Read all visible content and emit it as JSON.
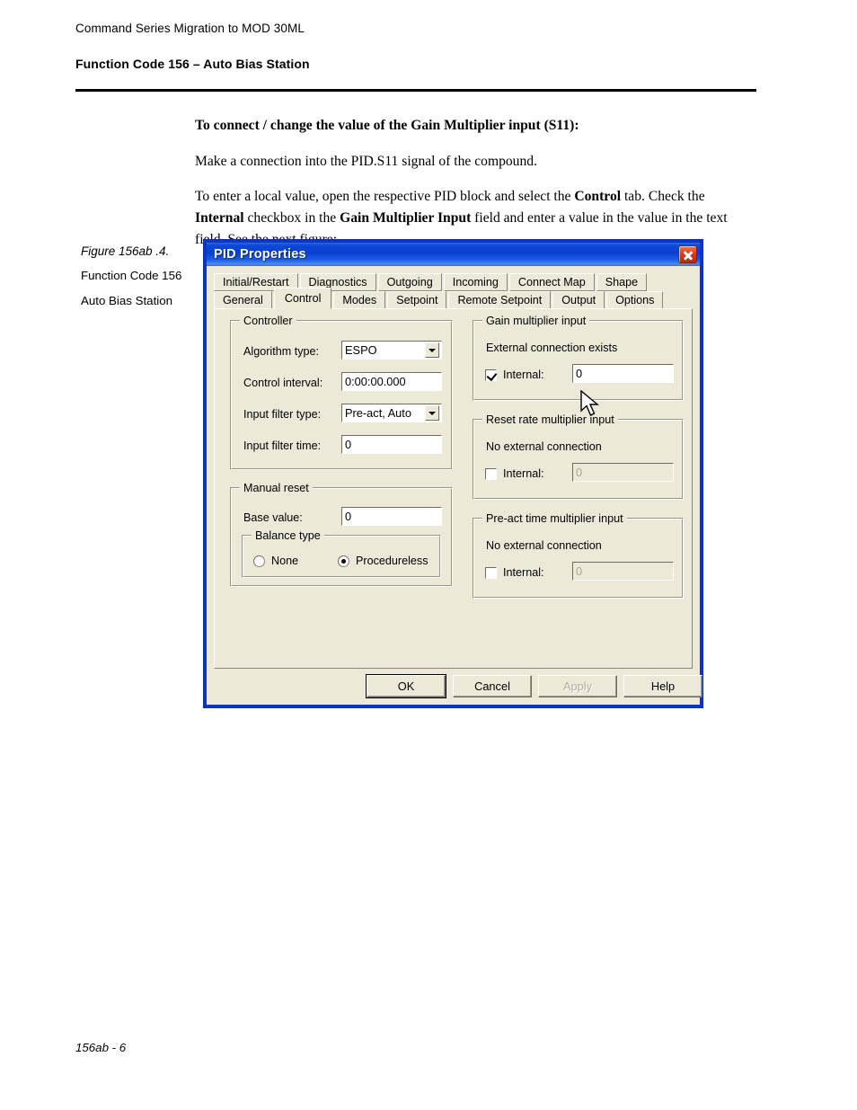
{
  "page": {
    "running_header": "Command Series Migration to MOD 30ML",
    "section_title": "Function Code 156 – Auto Bias Station",
    "footer": "156ab - 6"
  },
  "body": {
    "heading": "To connect / change the value of the Gain Multiplier input (S11):",
    "para1": "Make a connection into the PID.S11 signal of the compound.",
    "para2_a": "To enter a local value, open the respective PID block and select the ",
    "para2_b": "Control",
    "para2_c": " tab. Check the ",
    "para2_d": "Internal",
    "para2_e": " checkbox in the ",
    "para2_f": "Gain Multiplier Input",
    "para2_g": " field and enter a value in the  value in the text field. See the next figure:"
  },
  "caption": {
    "figure": "Figure 156ab .4.",
    "line1": "Function Code 156",
    "line2": "Auto Bias Station"
  },
  "dialog": {
    "title": "PID Properties",
    "close_icon": "close-icon",
    "tabs_row1": [
      {
        "label": "Initial/Restart",
        "selected": false
      },
      {
        "label": "Diagnostics",
        "selected": false
      },
      {
        "label": "Outgoing",
        "selected": false
      },
      {
        "label": "Incoming",
        "selected": false
      },
      {
        "label": "Connect Map",
        "selected": false
      },
      {
        "label": "Shape",
        "selected": false
      }
    ],
    "tabs_row2": [
      {
        "label": "General",
        "selected": false
      },
      {
        "label": "Control",
        "selected": true
      },
      {
        "label": "Modes",
        "selected": false
      },
      {
        "label": "Setpoint",
        "selected": false
      },
      {
        "label": "Remote Setpoint",
        "selected": false
      },
      {
        "label": "Output",
        "selected": false
      },
      {
        "label": "Options",
        "selected": false
      }
    ],
    "controller": {
      "legend": "Controller",
      "algorithm_type_label": "Algorithm type:",
      "algorithm_type_value": "ESPO",
      "control_interval_label": "Control interval:",
      "control_interval_value": "0:00:00.000",
      "input_filter_type_label": "Input filter type:",
      "input_filter_type_value": "Pre-act, Auto",
      "input_filter_time_label": "Input filter time:",
      "input_filter_time_value": "0"
    },
    "manual_reset": {
      "legend": "Manual reset",
      "base_value_label": "Base value:",
      "base_value": "0",
      "balance_legend": "Balance type",
      "option_none": "None",
      "option_procedureless": "Procedureless",
      "selected_option": "Procedureless"
    },
    "gain_multiplier": {
      "legend": "Gain multiplier input",
      "status": "External connection exists",
      "internal_label": "Internal:",
      "internal_checked": true,
      "internal_value": "0",
      "internal_enabled": true
    },
    "reset_rate_multiplier": {
      "legend": "Reset rate multiplier input",
      "status": "No external connection",
      "internal_label": "Internal:",
      "internal_checked": false,
      "internal_value": "0",
      "internal_enabled": false
    },
    "preact_time_multiplier": {
      "legend": "Pre-act time multiplier input",
      "status": "No external connection",
      "internal_label": "Internal:",
      "internal_checked": false,
      "internal_value": "0",
      "internal_enabled": false
    },
    "buttons": {
      "ok": "OK",
      "cancel": "Cancel",
      "apply": "Apply",
      "apply_disabled": true,
      "help": "Help"
    },
    "colors": {
      "titlebar_blue": "#0a3fd2",
      "frame_blue": "#0a36c8",
      "face": "#ece9d8",
      "close_red": "#de3b17"
    }
  }
}
